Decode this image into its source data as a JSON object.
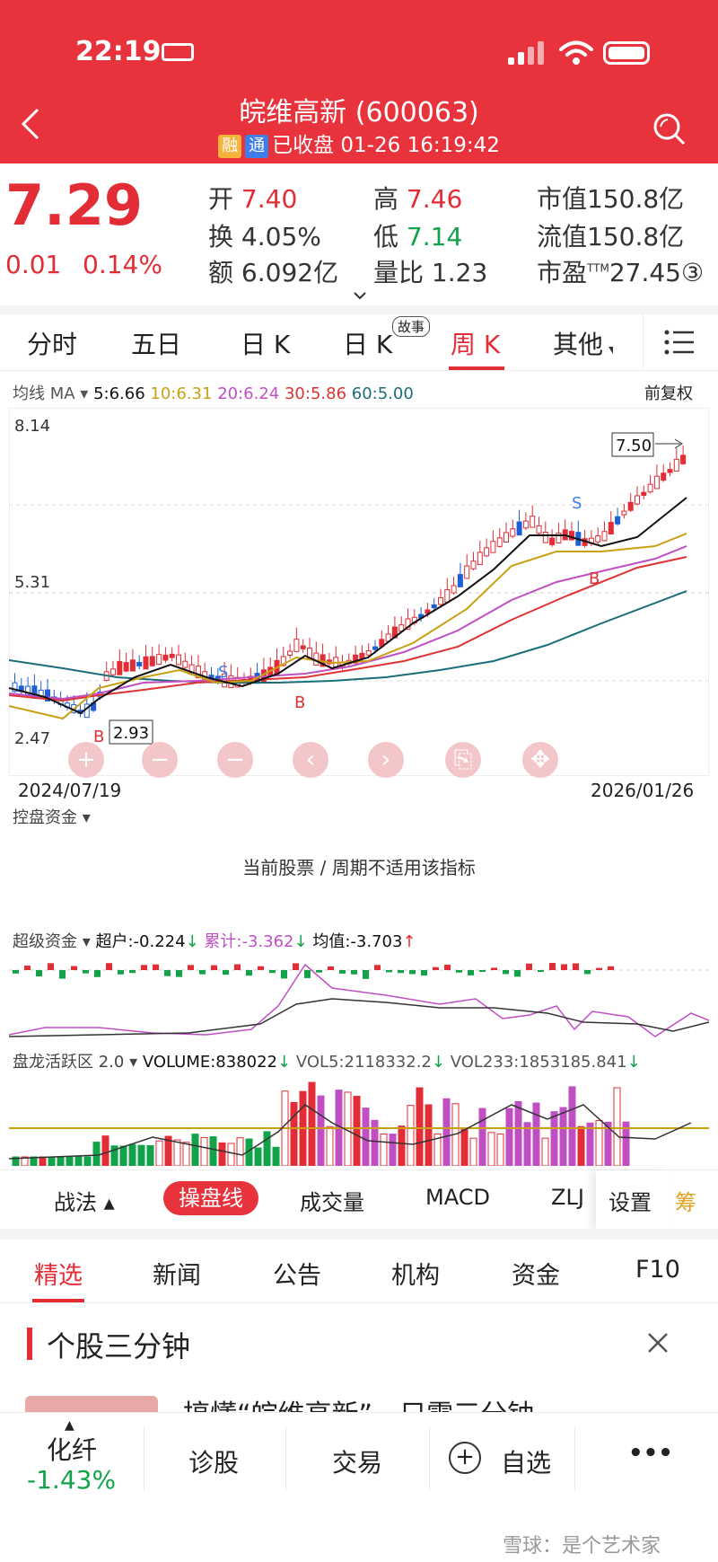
{
  "status_bar": {
    "time": "22:19"
  },
  "header": {
    "title": "皖维高新 (600063)",
    "tag1": "融",
    "tag2": "通",
    "status": "已收盘 01-26 16:19:42"
  },
  "quote": {
    "price": "7.29",
    "change": "0.01",
    "change_pct": "0.14%",
    "open_label": "开",
    "open": "7.40",
    "high_label": "高",
    "high": "7.46",
    "mktcap_label": "市值",
    "mktcap": "150.8亿",
    "turnover_label": "换",
    "turnover": "4.05%",
    "low_label": "低",
    "low": "7.14",
    "float_label": "流值",
    "float": "150.8亿",
    "amount_label": "额",
    "amount": "6.092亿",
    "volratio_label": "量比",
    "volratio": "1.23",
    "pe_label": "市盈",
    "pe_sup": "TTM",
    "pe": "27.45",
    "pe_badge": "③"
  },
  "tabs": [
    "分时",
    "五日",
    "日 K",
    "日 K",
    "周 K",
    "其他"
  ],
  "tabs_story": "故事",
  "active_tab": "周 K",
  "ma_bar": {
    "label": "均线 MA",
    "ma5": "5:6.66",
    "ma10": "10:6.31",
    "ma20": "20:6.24",
    "ma30": "30:5.86",
    "ma60": "60:5.00",
    "adjust": "前复权"
  },
  "kline": {
    "y_top": "8.14",
    "y_mid": "5.31",
    "y_bot": "2.47",
    "high_mark": "7.50",
    "low_mark": "2.93",
    "date_start": "2024/07/19",
    "date_end": "2026/01/26",
    "s_label": "S",
    "b_label": "B"
  },
  "control_panel": {
    "label": "控盘资金",
    "message": "当前股票 / 周期不适用该指标"
  },
  "super_panel": {
    "label": "超级资金",
    "chaohu": "超户:-0.224",
    "leiji": "累计:-3.362",
    "junzhi": "均值:-3.703"
  },
  "volume_panel": {
    "label": "盘龙活跃区 2.0",
    "volume": "VOLUME:838022",
    "vol5": "VOL5:2118332.2",
    "vol233": "VOL233:1853185.841"
  },
  "toolbar": {
    "zhanfa": "战法",
    "caopan": "操盘线",
    "chengjiao": "成交量",
    "macd": "MACD",
    "zlj": "ZLJ",
    "settings": "设置",
    "chou": "筹"
  },
  "news_tabs": [
    "精选",
    "新闻",
    "公告",
    "机构",
    "资金",
    "F10"
  ],
  "section": {
    "title": "个股三分钟",
    "preview": "搞懂“皖维高新”，只需三分钟"
  },
  "bottom_bar": {
    "sector": "化纤",
    "sector_change": "-1.43%",
    "diagnose": "诊股",
    "trade": "交易",
    "watch": "自选",
    "more": "•••",
    "watermark": "雪球：是个艺术家"
  },
  "colors": {
    "accent": "#e8323c",
    "up": "#e22d36",
    "down": "#12a34a"
  }
}
